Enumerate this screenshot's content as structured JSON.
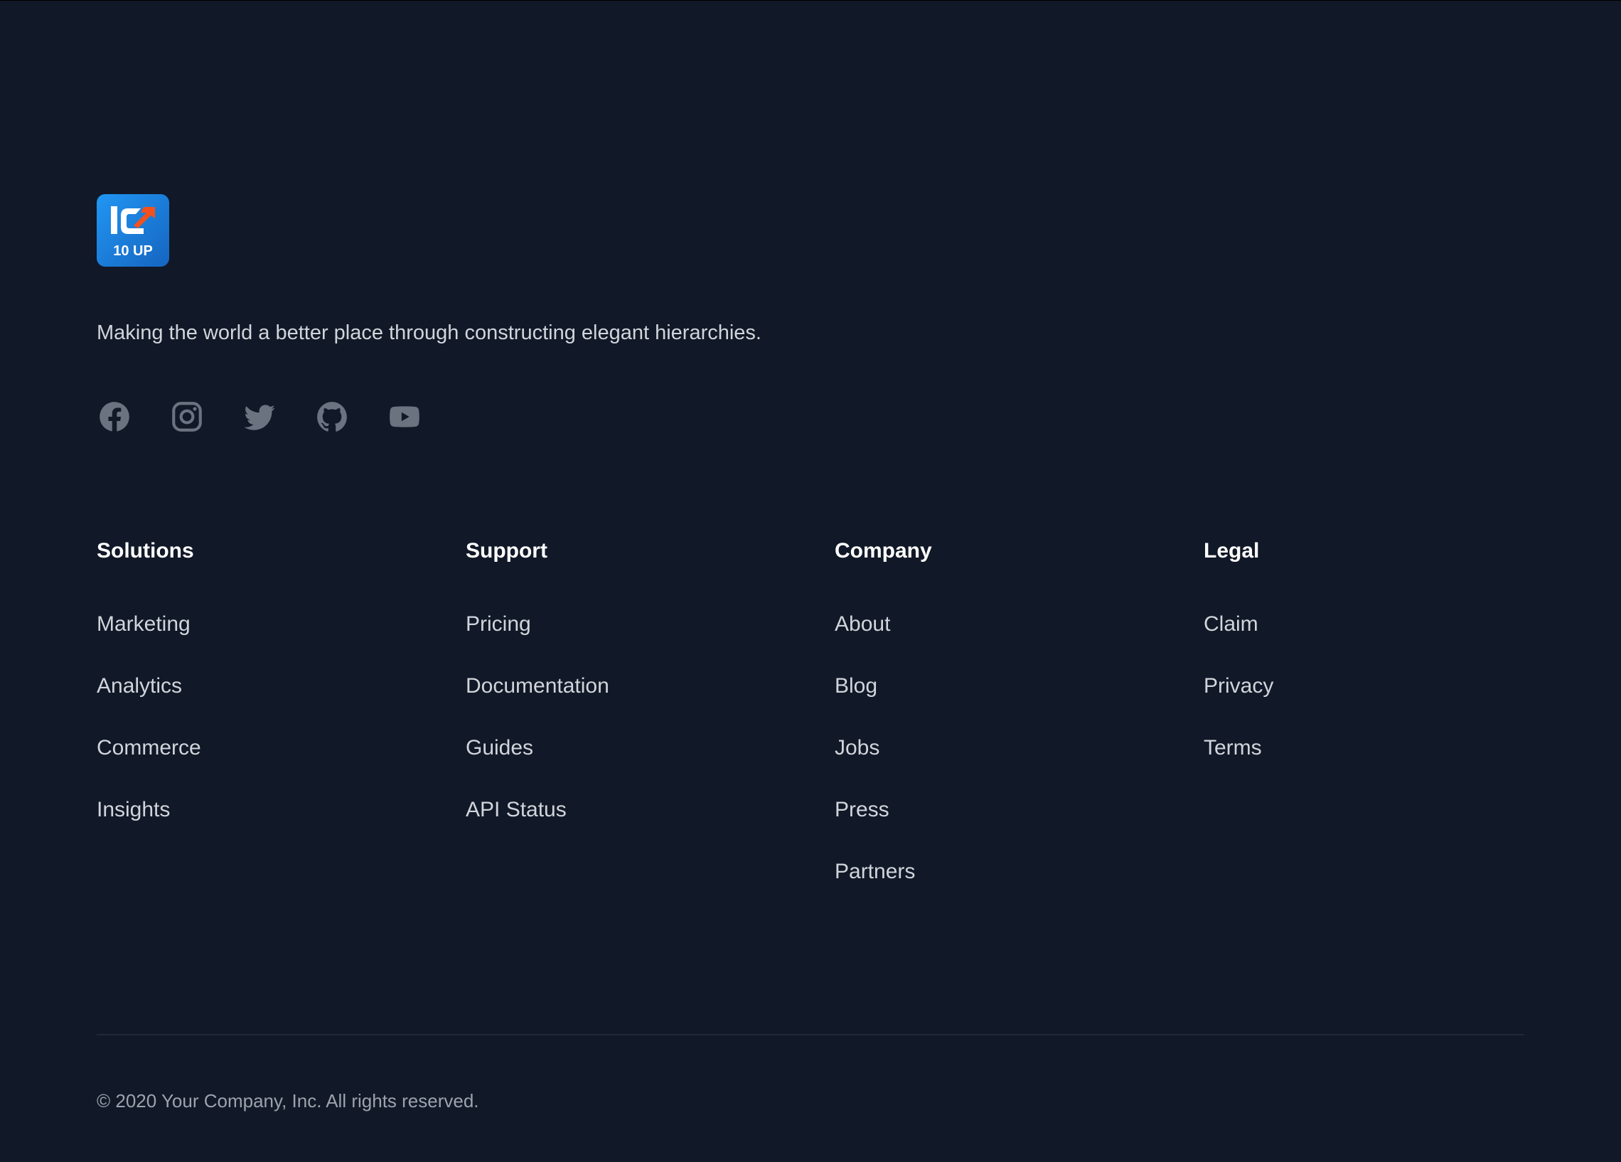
{
  "brand": {
    "logo_text": "10 UP",
    "logo_colors": {
      "background": "#1e88e5",
      "arrow": "#f4511e",
      "mark": "#ffffff"
    },
    "tagline": "Making the world a better place through constructing elegant hierarchies."
  },
  "social": [
    {
      "name": "Facebook",
      "icon": "facebook-icon"
    },
    {
      "name": "Instagram",
      "icon": "instagram-icon"
    },
    {
      "name": "Twitter",
      "icon": "twitter-icon"
    },
    {
      "name": "GitHub",
      "icon": "github-icon"
    },
    {
      "name": "YouTube",
      "icon": "youtube-icon"
    }
  ],
  "columns": [
    {
      "heading": "Solutions",
      "links": [
        "Marketing",
        "Analytics",
        "Commerce",
        "Insights"
      ]
    },
    {
      "heading": "Support",
      "links": [
        "Pricing",
        "Documentation",
        "Guides",
        "API Status"
      ]
    },
    {
      "heading": "Company",
      "links": [
        "About",
        "Blog",
        "Jobs",
        "Press",
        "Partners"
      ]
    },
    {
      "heading": "Legal",
      "links": [
        "Claim",
        "Privacy",
        "Terms"
      ]
    }
  ],
  "copyright": "© 2020 Your Company, Inc. All rights reserved.",
  "colors": {
    "background": "#111827",
    "heading": "#ffffff",
    "link": "#d1d5db",
    "icon": "#6b7280",
    "muted": "#9ca3af",
    "divider": "#1f2937"
  }
}
